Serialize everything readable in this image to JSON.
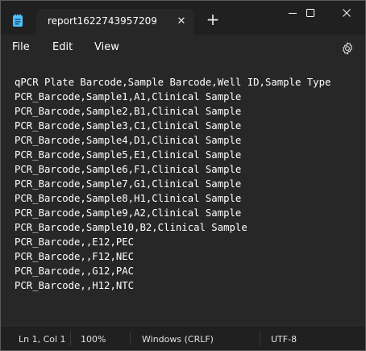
{
  "window": {
    "tab_title": "report1622743957209",
    "tab_close_glyph": "✕",
    "new_tab_glyph": "+"
  },
  "menu": {
    "file": "File",
    "edit": "Edit",
    "view": "View"
  },
  "editor": {
    "lines": [
      "qPCR Plate Barcode,Sample Barcode,Well ID,Sample Type",
      "PCR_Barcode,Sample1,A1,Clinical Sample",
      "PCR_Barcode,Sample2,B1,Clinical Sample",
      "PCR_Barcode,Sample3,C1,Clinical Sample",
      "PCR_Barcode,Sample4,D1,Clinical Sample",
      "PCR_Barcode,Sample5,E1,Clinical Sample",
      "PCR_Barcode,Sample6,F1,Clinical Sample",
      "PCR_Barcode,Sample7,G1,Clinical Sample",
      "PCR_Barcode,Sample8,H1,Clinical Sample",
      "PCR_Barcode,Sample9,A2,Clinical Sample",
      "PCR_Barcode,Sample10,B2,Clinical Sample",
      "PCR_Barcode,,E12,PEC",
      "PCR_Barcode,,F12,NEC",
      "PCR_Barcode,,G12,PAC",
      "PCR_Barcode,,H12,NTC"
    ]
  },
  "status": {
    "position": "Ln 1, Col 1",
    "zoom": "100%",
    "line_ending": "Windows (CRLF)",
    "encoding": "UTF-8"
  },
  "icons": {
    "app": "notepad-icon",
    "settings": "gear-icon",
    "minimize": "minimize-icon",
    "maximize": "maximize-icon",
    "close": "close-icon"
  },
  "colors": {
    "titlebar": "#202020",
    "editor_background": "#272727",
    "text": "#ffffff",
    "app_icon": "#4cc2ff"
  }
}
